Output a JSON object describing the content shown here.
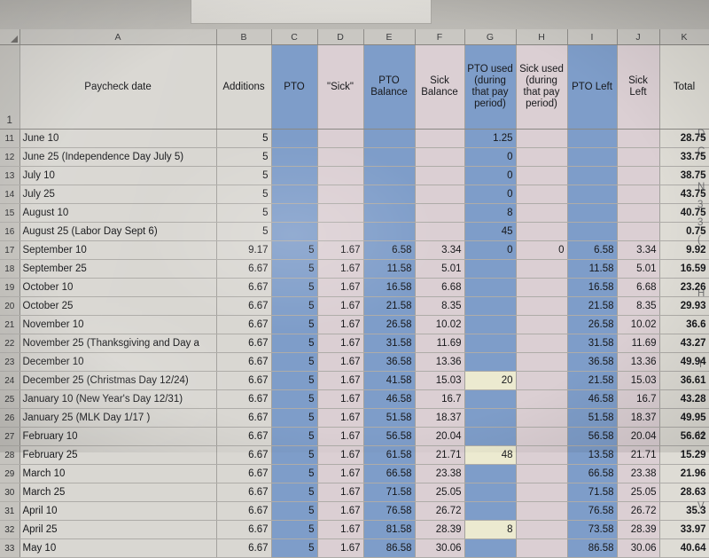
{
  "app": {
    "type": "spreadsheet",
    "select_all_icon": "select-all-corner-triangle"
  },
  "columns": {
    "letters": [
      "A",
      "B",
      "C",
      "D",
      "E",
      "F",
      "G",
      "H",
      "I",
      "J",
      "K"
    ],
    "headers": {
      "A": "Paycheck date",
      "B": "Additions",
      "C": "PTO",
      "D": "\"Sick\"",
      "E": "PTO Balance",
      "F": "Sick Balance",
      "G": "PTO used (during that pay period)",
      "H": "Sick used (during that pay period)",
      "I": "PTO Left",
      "J": "Sick Left",
      "K": "Total"
    },
    "fills": {
      "A": "plain",
      "B": "plain",
      "C": "blue",
      "D": "pink",
      "E": "blue",
      "F": "pink",
      "G": "blue",
      "H": "pink",
      "I": "blue",
      "J": "pink",
      "K": "total"
    }
  },
  "colors": {
    "blue_column": "#7e9dc9",
    "pink_column": "#dbcfd3",
    "plain_column": "#d9d7d2",
    "total_column": "#dedcd5",
    "highlight_yellow": "#ecead0",
    "header_strip": "#c9c7c2",
    "row_header": "#c5c3be",
    "grid_line": "#a3a19d",
    "text": "#17181b"
  },
  "header_row_label": "1",
  "rows": [
    {
      "n": "11",
      "A": "June 10",
      "B": "5",
      "C": "",
      "D": "",
      "E": "",
      "F": "",
      "G": "1.25",
      "H": "",
      "I": "",
      "J": "",
      "K": "28.75",
      "spill": "D"
    },
    {
      "n": "12",
      "A": "June 25 (Independence Day July 5)",
      "B": "5",
      "C": "",
      "D": "",
      "E": "",
      "F": "",
      "G": "0",
      "H": "",
      "I": "",
      "J": "",
      "K": "33.75",
      "spill": "C"
    },
    {
      "n": "13",
      "A": "July 10",
      "B": "5",
      "C": "",
      "D": "",
      "E": "",
      "F": "",
      "G": "0",
      "H": "",
      "I": "",
      "J": "",
      "K": "38.75",
      "spill": ""
    },
    {
      "n": "14",
      "A": "July 25",
      "B": "5",
      "C": "",
      "D": "",
      "E": "",
      "F": "",
      "G": "0",
      "H": "",
      "I": "",
      "J": "",
      "K": "43.75",
      "spill": "N"
    },
    {
      "n": "15",
      "A": "August 10",
      "B": "5",
      "C": "",
      "D": "",
      "E": "",
      "F": "",
      "G": "8",
      "H": "",
      "I": "",
      "J": "",
      "K": "40.75",
      "spill": "3"
    },
    {
      "n": "16",
      "A": "August 25 (Labor Day Sept 6)",
      "B": "5",
      "C": "",
      "D": "",
      "E": "",
      "F": "",
      "G": "45",
      "H": "",
      "I": "",
      "J": "",
      "K": "0.75",
      "spill": "3"
    },
    {
      "n": "17",
      "A": "September 10",
      "B": "9.17",
      "C": "5",
      "D": "1.67",
      "E": "6.58",
      "F": "3.34",
      "G": "0",
      "H": "0",
      "I": "6.58",
      "J": "3.34",
      "K": "9.92",
      "spill": "("
    },
    {
      "n": "18",
      "A": "September 25",
      "B": "6.67",
      "C": "5",
      "D": "1.67",
      "E": "11.58",
      "F": "5.01",
      "G": "",
      "H": "",
      "I": "11.58",
      "J": "5.01",
      "K": "16.59",
      "spill": ""
    },
    {
      "n": "19",
      "A": "October 10",
      "B": "6.67",
      "C": "5",
      "D": "1.67",
      "E": "16.58",
      "F": "6.68",
      "G": "",
      "H": "",
      "I": "16.58",
      "J": "6.68",
      "K": "23.26",
      "spill": ""
    },
    {
      "n": "20",
      "A": "October 25",
      "B": "6.67",
      "C": "5",
      "D": "1.67",
      "E": "21.58",
      "F": "8.35",
      "G": "",
      "H": "",
      "I": "21.58",
      "J": "8.35",
      "K": "29.93",
      "spill": "H"
    },
    {
      "n": "21",
      "A": "November 10",
      "B": "6.67",
      "C": "5",
      "D": "1.67",
      "E": "26.58",
      "F": "10.02",
      "G": "",
      "H": "",
      "I": "26.58",
      "J": "10.02",
      "K": "36.6",
      "spill": ""
    },
    {
      "n": "22",
      "A": "November 25 (Thanksgiving and Day a",
      "B": "6.67",
      "C": "5",
      "D": "1.67",
      "E": "31.58",
      "F": "11.69",
      "G": "",
      "H": "",
      "I": "31.58",
      "J": "11.69",
      "K": "43.27",
      "spill": ""
    },
    {
      "n": "23",
      "A": "December 10",
      "B": "6.67",
      "C": "5",
      "D": "1.67",
      "E": "36.58",
      "F": "13.36",
      "G": "",
      "H": "",
      "I": "36.58",
      "J": "13.36",
      "K": "49.94",
      "spill": ""
    },
    {
      "n": "24",
      "A": "December 25 (Christmas Day 12/24)",
      "B": "6.67",
      "C": "5",
      "D": "1.67",
      "E": "41.58",
      "F": "15.03",
      "G": "20",
      "H": "",
      "I": "21.58",
      "J": "15.03",
      "K": "36.61",
      "spill": "T",
      "g_highlight": true
    },
    {
      "n": "25",
      "A": "January 10 (New Year's Day 12/31)",
      "B": "6.67",
      "C": "5",
      "D": "1.67",
      "E": "46.58",
      "F": "16.7",
      "G": "",
      "H": "",
      "I": "46.58",
      "J": "16.7",
      "K": "43.28",
      "spill": ""
    },
    {
      "n": "26",
      "A": "January 25 (MLK Day 1/17 )",
      "B": "6.67",
      "C": "5",
      "D": "1.67",
      "E": "51.58",
      "F": "18.37",
      "G": "",
      "H": "",
      "I": "51.58",
      "J": "18.37",
      "K": "49.95",
      "spill": ""
    },
    {
      "n": "27",
      "A": "February 10",
      "B": "6.67",
      "C": "5",
      "D": "1.67",
      "E": "56.58",
      "F": "20.04",
      "G": "",
      "H": "",
      "I": "56.58",
      "J": "20.04",
      "K": "56.62",
      "spill": ""
    },
    {
      "n": "28",
      "A": "February 25",
      "B": "6.67",
      "C": "5",
      "D": "1.67",
      "E": "61.58",
      "F": "21.71",
      "G": "48",
      "H": "",
      "I": "13.58",
      "J": "21.71",
      "K": "15.29",
      "spill": "H",
      "g_highlight": true
    },
    {
      "n": "29",
      "A": "March 10",
      "B": "6.67",
      "C": "5",
      "D": "1.67",
      "E": "66.58",
      "F": "23.38",
      "G": "",
      "H": "",
      "I": "66.58",
      "J": "23.38",
      "K": "21.96",
      "spill": ""
    },
    {
      "n": "30",
      "A": "March 25",
      "B": "6.67",
      "C": "5",
      "D": "1.67",
      "E": "71.58",
      "F": "25.05",
      "G": "",
      "H": "",
      "I": "71.58",
      "J": "25.05",
      "K": "28.63",
      "spill": ""
    },
    {
      "n": "31",
      "A": "April 10",
      "B": "6.67",
      "C": "5",
      "D": "1.67",
      "E": "76.58",
      "F": "26.72",
      "G": "",
      "H": "",
      "I": "76.58",
      "J": "26.72",
      "K": "35.3",
      "spill": ""
    },
    {
      "n": "32",
      "A": "April 25",
      "B": "6.67",
      "C": "5",
      "D": "1.67",
      "E": "81.58",
      "F": "28.39",
      "G": "8",
      "H": "",
      "I": "73.58",
      "J": "28.39",
      "K": "33.97",
      "spill": "V",
      "g_highlight": true
    },
    {
      "n": "33",
      "A": "May 10",
      "B": "6.67",
      "C": "5",
      "D": "1.67",
      "E": "86.58",
      "F": "30.06",
      "G": "",
      "H": "",
      "I": "86.58",
      "J": "30.06",
      "K": "40.64",
      "spill": ""
    }
  ]
}
